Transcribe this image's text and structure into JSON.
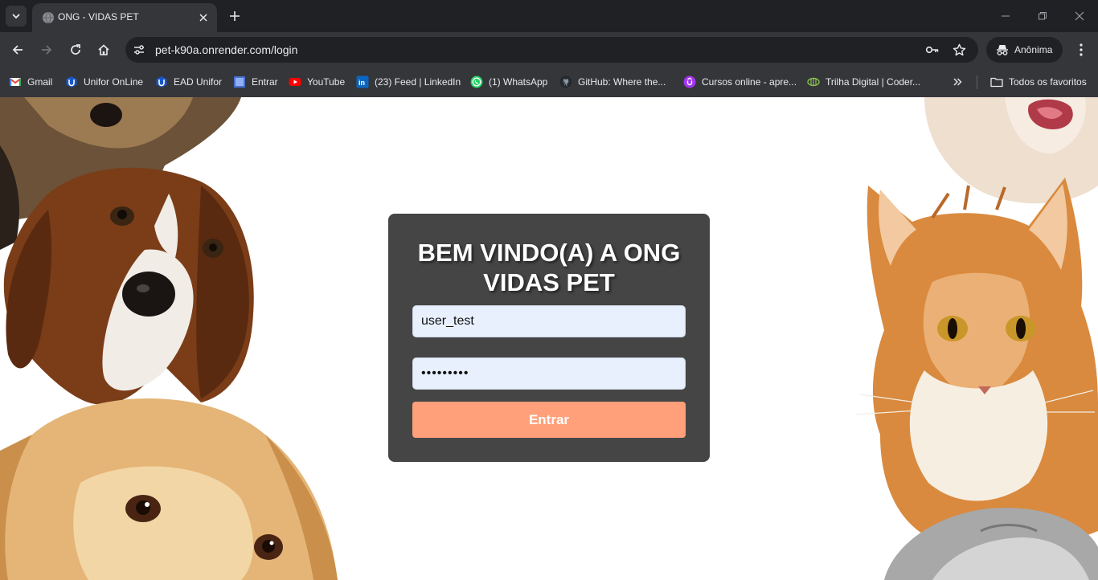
{
  "browser": {
    "tab": {
      "title": "ONG - VIDAS PET"
    },
    "url": "pet-k90a.onrender.com/login",
    "profile_label": "Anônima",
    "bookmarks": [
      {
        "label": "Gmail",
        "icon": "gmail-icon",
        "color": "#ea4335"
      },
      {
        "label": "Unifor OnLine",
        "icon": "unifor-icon",
        "color": "#1a56c6"
      },
      {
        "label": "EAD Unifor",
        "icon": "ead-unifor-icon",
        "color": "#1a56c6"
      },
      {
        "label": "Entrar",
        "icon": "entrar-icon",
        "color": "#4a6fd8"
      },
      {
        "label": "YouTube",
        "icon": "youtube-icon",
        "color": "#ff0000"
      },
      {
        "label": "(23) Feed | LinkedIn",
        "icon": "linkedin-icon",
        "color": "#0a66c2"
      },
      {
        "label": "(1) WhatsApp",
        "icon": "whatsapp-icon",
        "color": "#25d366"
      },
      {
        "label": "GitHub: Where the...",
        "icon": "github-icon",
        "color": "#24292f"
      },
      {
        "label": "Cursos online - apre...",
        "icon": "udemy-icon",
        "color": "#a435f0"
      },
      {
        "label": "Trilha Digital | Coder...",
        "icon": "trilha-digital-icon",
        "color": "#8bc34a"
      }
    ],
    "all_bookmarks_label": "Todos os favoritos"
  },
  "login": {
    "title": "BEM VINDO(A) A ONG VIDAS PET",
    "username_value": "user_test",
    "password_value": "password1",
    "submit_label": "Entrar"
  },
  "colors": {
    "card_bg": "#454545",
    "button_bg": "#ffa07a",
    "input_bg": "#e8f0fe"
  }
}
